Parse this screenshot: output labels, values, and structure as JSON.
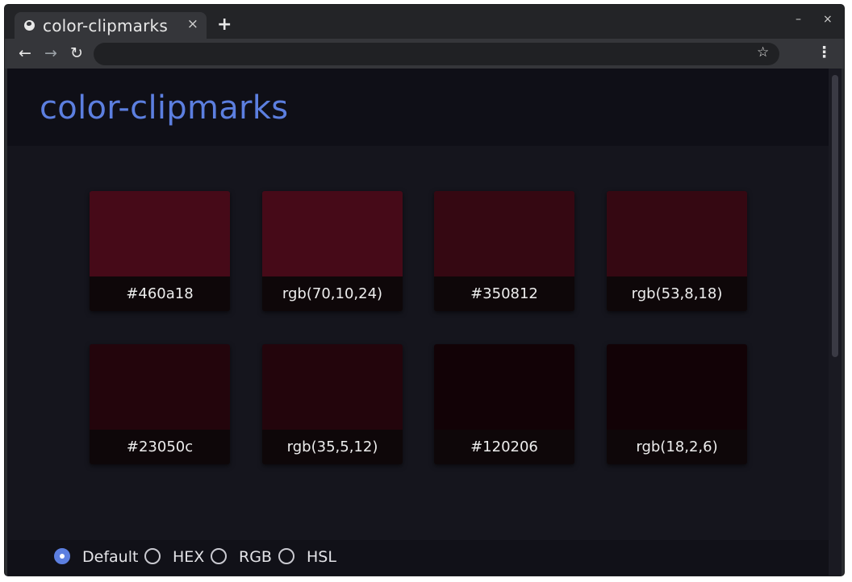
{
  "browser": {
    "tab_title": "color-clipmarks",
    "tab_close": "×",
    "new_tab": "+",
    "minimize": "–",
    "close": "×",
    "back_icon": "←",
    "forward_icon": "→",
    "reload_icon": "↻",
    "star_icon": "☆",
    "menu_icon": "⋮",
    "address": ""
  },
  "app": {
    "title": "color-clipmarks",
    "accent_color": "#5c7fe0"
  },
  "swatches": [
    {
      "label": "#460a18",
      "color": "#460a18"
    },
    {
      "label": "rgb(70,10,24)",
      "color": "#460a18"
    },
    {
      "label": "#350812",
      "color": "#350812"
    },
    {
      "label": "rgb(53,8,18)",
      "color": "#350812"
    },
    {
      "label": "#23050c",
      "color": "#23050c"
    },
    {
      "label": "rgb(35,5,12)",
      "color": "#23050c"
    },
    {
      "label": "#120206",
      "color": "#120206"
    },
    {
      "label": "rgb(18,2,6)",
      "color": "#120206"
    }
  ],
  "format_options": [
    {
      "label": "Default",
      "checked": true
    },
    {
      "label": "HEX",
      "checked": false
    },
    {
      "label": "RGB",
      "checked": false
    },
    {
      "label": "HSL",
      "checked": false
    }
  ]
}
